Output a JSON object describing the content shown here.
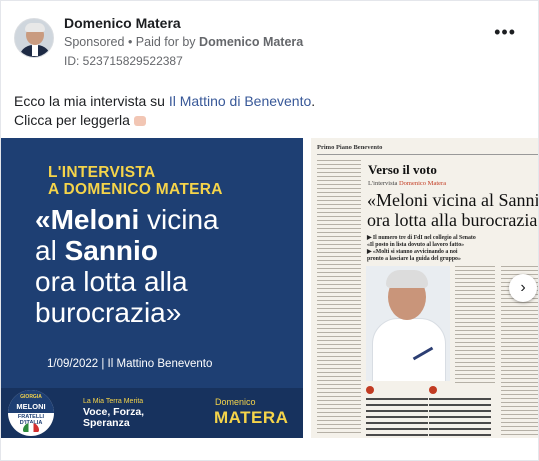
{
  "post": {
    "author": "Domenico Matera",
    "sponsored": "Sponsored",
    "paid_for_prefix": "• Paid for by",
    "paid_for_by": "Domenico Matera",
    "ad_id": "ID: 523715829522387",
    "more_label": "•••",
    "text_line1_prefix": "Ecco la mia intervista su ",
    "text_line1_link": "Il Mattino di Benevento",
    "text_line1_suffix": ".",
    "text_line2": "Clicca per leggerla"
  },
  "creative_left": {
    "kicker_line1": "L'INTERVISTA",
    "kicker_line2": "A DOMENICO MATERA",
    "headline_l1_a": "«",
    "headline_l1_b": "Meloni",
    "headline_l1_c": " vicina",
    "headline_l2_a": "al ",
    "headline_l2_b": "Sannio",
    "headline_l3": "ora lotta alla",
    "headline_l4": "burocrazia»",
    "date": "1/09/2022 | Il Mattino Benevento",
    "badge_top": "GIORGIA",
    "badge_name": "MELONI",
    "badge_sub": "FRATELLI D'ITALIA",
    "slogan_small": "La Mia Terra Merita",
    "slogan_big_1": "Voce, Forza,",
    "slogan_big_2": "Speranza",
    "candidate_first": "Domenico",
    "candidate_last": "MATERA",
    "colors": {
      "background": "#1e3f73",
      "accent": "#f5d44a"
    }
  },
  "creative_right": {
    "section": "Primo Piano Benevento",
    "kicker": "Verso il voto",
    "subkicker_prefix": "L'intervista ",
    "subkicker_name": "Domenico Matera",
    "title_l1": "«Meloni vicina al Sannio",
    "title_l2": "ora lotta alla burocrazia»",
    "lede_1": "▶ Il numero tre di FdI nel collegio al Senato",
    "lede_2": "«Il posto in lista dovuto al lavoro fatto»",
    "lede_3": "▶ «Molti si stanno avvicinando a noi",
    "lede_4": "pronto a lasciare la guida del gruppo»"
  },
  "carousel": {
    "next_icon": "›"
  }
}
